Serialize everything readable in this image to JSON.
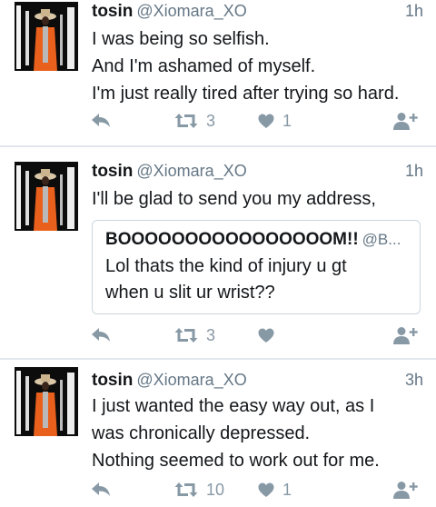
{
  "tweets": [
    {
      "author_name": "tosin",
      "author_handle": "@Xiomara_XO",
      "time": "1h",
      "lines": [
        "I was being so selfish.",
        "And I'm ashamed of myself.",
        "I'm just really tired after trying so hard."
      ],
      "retweet_count": "3",
      "like_count": "1"
    },
    {
      "author_name": "tosin",
      "author_handle": "@Xiomara_XO",
      "time": "1h",
      "lines": [
        "I'll be glad to send you my address,"
      ],
      "quote": {
        "name": "BOOOOOOOOOOOOOOOOM!!",
        "handle": "@B...",
        "lines": [
          "Lol thats the kind of injury u gt",
          "when u slit ur wrist??"
        ]
      },
      "retweet_count": "3",
      "like_count": ""
    },
    {
      "author_name": "tosin",
      "author_handle": "@Xiomara_XO",
      "time": "3h",
      "lines": [
        "I just wanted the easy way out, as I",
        "was chronically depressed.",
        "Nothing seemed to work out for me."
      ],
      "retweet_count": "10",
      "like_count": "1"
    }
  ],
  "icons": {
    "reply": "reply-icon",
    "retweet": "retweet-icon",
    "like": "heart-icon",
    "follow": "follow-icon"
  },
  "colors": {
    "icon_gray": "#8899a6",
    "handle_gray": "#657786",
    "divider": "#e1e8ed",
    "avatar_orange": "#e8601c"
  }
}
